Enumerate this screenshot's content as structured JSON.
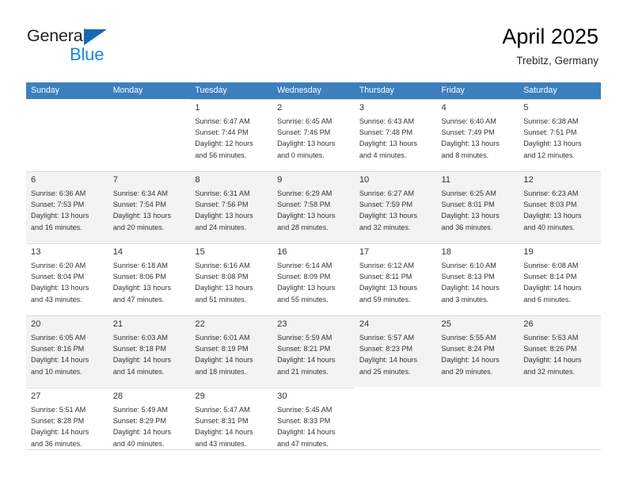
{
  "brand": {
    "name_part1": "General",
    "name_part2": "Blue",
    "triangle_color": "#1668b3",
    "blue_color": "#1b87d4"
  },
  "header": {
    "title": "April 2025",
    "location": "Trebitz, Germany"
  },
  "calendar": {
    "header_bg": "#3d7ebd",
    "shaded_row_bg": "#f3f3f3",
    "weekdays": [
      "Sunday",
      "Monday",
      "Tuesday",
      "Wednesday",
      "Thursday",
      "Friday",
      "Saturday"
    ],
    "weeks": [
      {
        "shaded": false,
        "days": [
          {
            "num": "",
            "sunrise": "",
            "sunset": "",
            "daylight_line1": "",
            "daylight_line2": ""
          },
          {
            "num": "",
            "sunrise": "",
            "sunset": "",
            "daylight_line1": "",
            "daylight_line2": ""
          },
          {
            "num": "1",
            "sunrise": "Sunrise: 6:47 AM",
            "sunset": "Sunset: 7:44 PM",
            "daylight_line1": "Daylight: 12 hours",
            "daylight_line2": "and 56 minutes."
          },
          {
            "num": "2",
            "sunrise": "Sunrise: 6:45 AM",
            "sunset": "Sunset: 7:46 PM",
            "daylight_line1": "Daylight: 13 hours",
            "daylight_line2": "and 0 minutes."
          },
          {
            "num": "3",
            "sunrise": "Sunrise: 6:43 AM",
            "sunset": "Sunset: 7:48 PM",
            "daylight_line1": "Daylight: 13 hours",
            "daylight_line2": "and 4 minutes."
          },
          {
            "num": "4",
            "sunrise": "Sunrise: 6:40 AM",
            "sunset": "Sunset: 7:49 PM",
            "daylight_line1": "Daylight: 13 hours",
            "daylight_line2": "and 8 minutes."
          },
          {
            "num": "5",
            "sunrise": "Sunrise: 6:38 AM",
            "sunset": "Sunset: 7:51 PM",
            "daylight_line1": "Daylight: 13 hours",
            "daylight_line2": "and 12 minutes."
          }
        ]
      },
      {
        "shaded": true,
        "days": [
          {
            "num": "6",
            "sunrise": "Sunrise: 6:36 AM",
            "sunset": "Sunset: 7:53 PM",
            "daylight_line1": "Daylight: 13 hours",
            "daylight_line2": "and 16 minutes."
          },
          {
            "num": "7",
            "sunrise": "Sunrise: 6:34 AM",
            "sunset": "Sunset: 7:54 PM",
            "daylight_line1": "Daylight: 13 hours",
            "daylight_line2": "and 20 minutes."
          },
          {
            "num": "8",
            "sunrise": "Sunrise: 6:31 AM",
            "sunset": "Sunset: 7:56 PM",
            "daylight_line1": "Daylight: 13 hours",
            "daylight_line2": "and 24 minutes."
          },
          {
            "num": "9",
            "sunrise": "Sunrise: 6:29 AM",
            "sunset": "Sunset: 7:58 PM",
            "daylight_line1": "Daylight: 13 hours",
            "daylight_line2": "and 28 minutes."
          },
          {
            "num": "10",
            "sunrise": "Sunrise: 6:27 AM",
            "sunset": "Sunset: 7:59 PM",
            "daylight_line1": "Daylight: 13 hours",
            "daylight_line2": "and 32 minutes."
          },
          {
            "num": "11",
            "sunrise": "Sunrise: 6:25 AM",
            "sunset": "Sunset: 8:01 PM",
            "daylight_line1": "Daylight: 13 hours",
            "daylight_line2": "and 36 minutes."
          },
          {
            "num": "12",
            "sunrise": "Sunrise: 6:23 AM",
            "sunset": "Sunset: 8:03 PM",
            "daylight_line1": "Daylight: 13 hours",
            "daylight_line2": "and 40 minutes."
          }
        ]
      },
      {
        "shaded": false,
        "days": [
          {
            "num": "13",
            "sunrise": "Sunrise: 6:20 AM",
            "sunset": "Sunset: 8:04 PM",
            "daylight_line1": "Daylight: 13 hours",
            "daylight_line2": "and 43 minutes."
          },
          {
            "num": "14",
            "sunrise": "Sunrise: 6:18 AM",
            "sunset": "Sunset: 8:06 PM",
            "daylight_line1": "Daylight: 13 hours",
            "daylight_line2": "and 47 minutes."
          },
          {
            "num": "15",
            "sunrise": "Sunrise: 6:16 AM",
            "sunset": "Sunset: 8:08 PM",
            "daylight_line1": "Daylight: 13 hours",
            "daylight_line2": "and 51 minutes."
          },
          {
            "num": "16",
            "sunrise": "Sunrise: 6:14 AM",
            "sunset": "Sunset: 8:09 PM",
            "daylight_line1": "Daylight: 13 hours",
            "daylight_line2": "and 55 minutes."
          },
          {
            "num": "17",
            "sunrise": "Sunrise: 6:12 AM",
            "sunset": "Sunset: 8:11 PM",
            "daylight_line1": "Daylight: 13 hours",
            "daylight_line2": "and 59 minutes."
          },
          {
            "num": "18",
            "sunrise": "Sunrise: 6:10 AM",
            "sunset": "Sunset: 8:13 PM",
            "daylight_line1": "Daylight: 14 hours",
            "daylight_line2": "and 3 minutes."
          },
          {
            "num": "19",
            "sunrise": "Sunrise: 6:08 AM",
            "sunset": "Sunset: 8:14 PM",
            "daylight_line1": "Daylight: 14 hours",
            "daylight_line2": "and 6 minutes."
          }
        ]
      },
      {
        "shaded": true,
        "days": [
          {
            "num": "20",
            "sunrise": "Sunrise: 6:05 AM",
            "sunset": "Sunset: 8:16 PM",
            "daylight_line1": "Daylight: 14 hours",
            "daylight_line2": "and 10 minutes."
          },
          {
            "num": "21",
            "sunrise": "Sunrise: 6:03 AM",
            "sunset": "Sunset: 8:18 PM",
            "daylight_line1": "Daylight: 14 hours",
            "daylight_line2": "and 14 minutes."
          },
          {
            "num": "22",
            "sunrise": "Sunrise: 6:01 AM",
            "sunset": "Sunset: 8:19 PM",
            "daylight_line1": "Daylight: 14 hours",
            "daylight_line2": "and 18 minutes."
          },
          {
            "num": "23",
            "sunrise": "Sunrise: 5:59 AM",
            "sunset": "Sunset: 8:21 PM",
            "daylight_line1": "Daylight: 14 hours",
            "daylight_line2": "and 21 minutes."
          },
          {
            "num": "24",
            "sunrise": "Sunrise: 5:57 AM",
            "sunset": "Sunset: 8:23 PM",
            "daylight_line1": "Daylight: 14 hours",
            "daylight_line2": "and 25 minutes."
          },
          {
            "num": "25",
            "sunrise": "Sunrise: 5:55 AM",
            "sunset": "Sunset: 8:24 PM",
            "daylight_line1": "Daylight: 14 hours",
            "daylight_line2": "and 29 minutes."
          },
          {
            "num": "26",
            "sunrise": "Sunrise: 5:53 AM",
            "sunset": "Sunset: 8:26 PM",
            "daylight_line1": "Daylight: 14 hours",
            "daylight_line2": "and 32 minutes."
          }
        ]
      },
      {
        "shaded": false,
        "days": [
          {
            "num": "27",
            "sunrise": "Sunrise: 5:51 AM",
            "sunset": "Sunset: 8:28 PM",
            "daylight_line1": "Daylight: 14 hours",
            "daylight_line2": "and 36 minutes."
          },
          {
            "num": "28",
            "sunrise": "Sunrise: 5:49 AM",
            "sunset": "Sunset: 8:29 PM",
            "daylight_line1": "Daylight: 14 hours",
            "daylight_line2": "and 40 minutes."
          },
          {
            "num": "29",
            "sunrise": "Sunrise: 5:47 AM",
            "sunset": "Sunset: 8:31 PM",
            "daylight_line1": "Daylight: 14 hours",
            "daylight_line2": "and 43 minutes."
          },
          {
            "num": "30",
            "sunrise": "Sunrise: 5:45 AM",
            "sunset": "Sunset: 8:33 PM",
            "daylight_line1": "Daylight: 14 hours",
            "daylight_line2": "and 47 minutes."
          },
          {
            "num": "",
            "sunrise": "",
            "sunset": "",
            "daylight_line1": "",
            "daylight_line2": ""
          },
          {
            "num": "",
            "sunrise": "",
            "sunset": "",
            "daylight_line1": "",
            "daylight_line2": ""
          },
          {
            "num": "",
            "sunrise": "",
            "sunset": "",
            "daylight_line1": "",
            "daylight_line2": ""
          }
        ]
      }
    ]
  }
}
